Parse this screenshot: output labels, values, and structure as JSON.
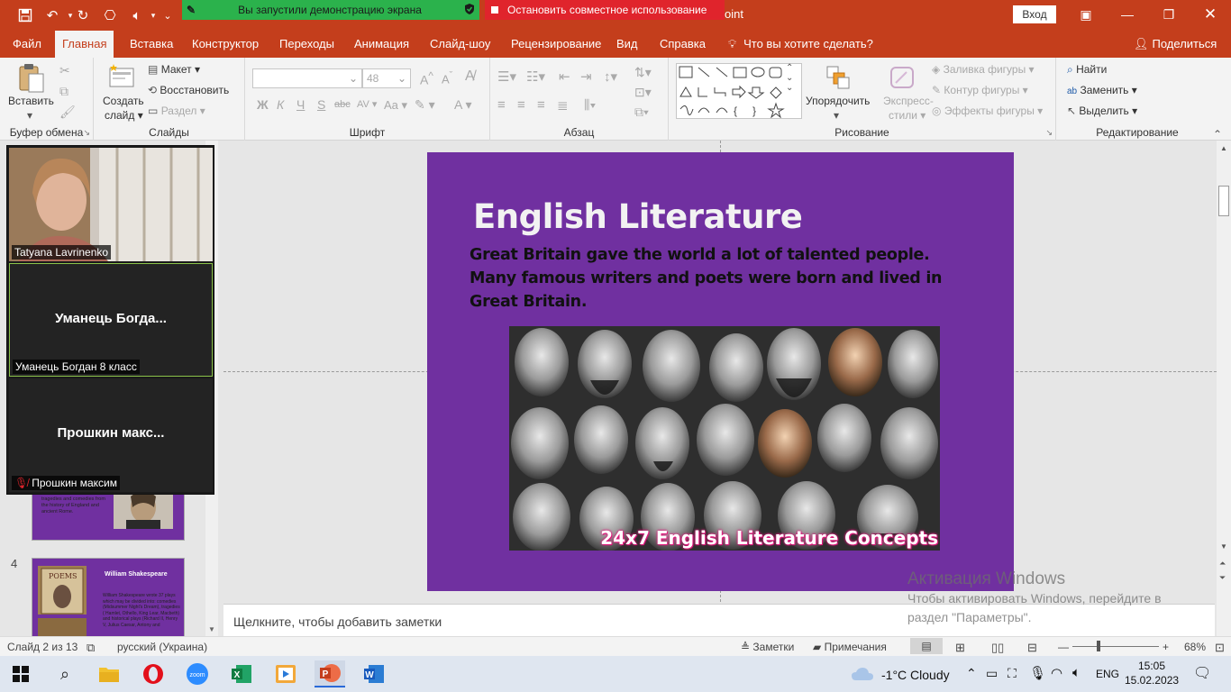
{
  "titlebar": {
    "share_banner": "Вы запустили демонстрацию экрана",
    "stop_share": "Остановить совместное использование",
    "title_fragment": "oint",
    "signin": "Вход"
  },
  "tabs": [
    "Файл",
    "Главная",
    "Вставка",
    "Конструктор",
    "Переходы",
    "Анимация",
    "Слайд-шоу",
    "Рецензирование",
    "Вид",
    "Справка",
    "Что вы хотите сделать?"
  ],
  "share_label": "Поделиться",
  "ribbon": {
    "clipboard": {
      "paste": "Вставить",
      "group": "Буфер обмена"
    },
    "slides": {
      "new_slide_1": "Создать",
      "new_slide_2": "слайд",
      "layout": "Макет",
      "reset": "Восстановить",
      "section": "Раздел",
      "group": "Слайды"
    },
    "font": {
      "size": "48",
      "bold": "Ж",
      "italic": "К",
      "underline": "Ч",
      "strike": "S",
      "strike2": "abc",
      "spacing": "AV",
      "case": "Aa",
      "group": "Шрифт"
    },
    "paragraph": {
      "group": "Абзац"
    },
    "drawing": {
      "arrange": "Упорядочить",
      "quick_styles_1": "Экспресс-",
      "quick_styles_2": "стили",
      "fill": "Заливка фигуры",
      "outline": "Контур фигуры",
      "effects": "Эффекты фигуры",
      "group": "Рисование"
    },
    "editing": {
      "find": "Найти",
      "replace": "Заменить",
      "select": "Выделить",
      "group": "Редактирование"
    }
  },
  "video": {
    "tiles": [
      {
        "name": "Tatyana Lavrinenko"
      },
      {
        "center": "Уманець  Богда...",
        "name": "Уманець Богдан 8 класс"
      },
      {
        "center": "Прошкин  макс...",
        "name": "Прошкин максим"
      }
    ]
  },
  "thumbnails": {
    "slide3_text": "tragedies and comedies from the history of England and ancient Rome.",
    "slide4_number": "4",
    "slide4_title": "William Shakespeare",
    "slide4_text": "William Shakespeare wrote 37 plays which may be divided into: comedies (Midsummer Night's Dream), tragedies ( Hamlet, Othello, King Lear, Macbeth) and historical plays (Richard II, Henry V, Julius Caesar, Antony and"
  },
  "slide": {
    "title": "English Literature",
    "body": "Great Britain gave the world a lot of talented people. Many famous writers and poets were born and lived in Great Britain.",
    "image_caption": "24x7 English Literature Concepts"
  },
  "notes_placeholder": "Щелкните, чтобы добавить заметки",
  "activation": {
    "title": "Активация Windows",
    "text": "Чтобы активировать Windows, перейдите в раздел \"Параметры\"."
  },
  "status": {
    "slide_counter": "Слайд 2 из 13",
    "language": "русский (Украина)",
    "notes": "Заметки",
    "comments": "Примечания",
    "zoom": "68%"
  },
  "taskbar": {
    "weather": "-1°C  Cloudy",
    "lang": "ENG",
    "time": "15:05",
    "date": "15.02.2023"
  },
  "colors": {
    "accent": "#c43e1c",
    "slide_bg": "#7030a0",
    "share_green": "#2bb24c",
    "stop_red": "#e0242c"
  }
}
